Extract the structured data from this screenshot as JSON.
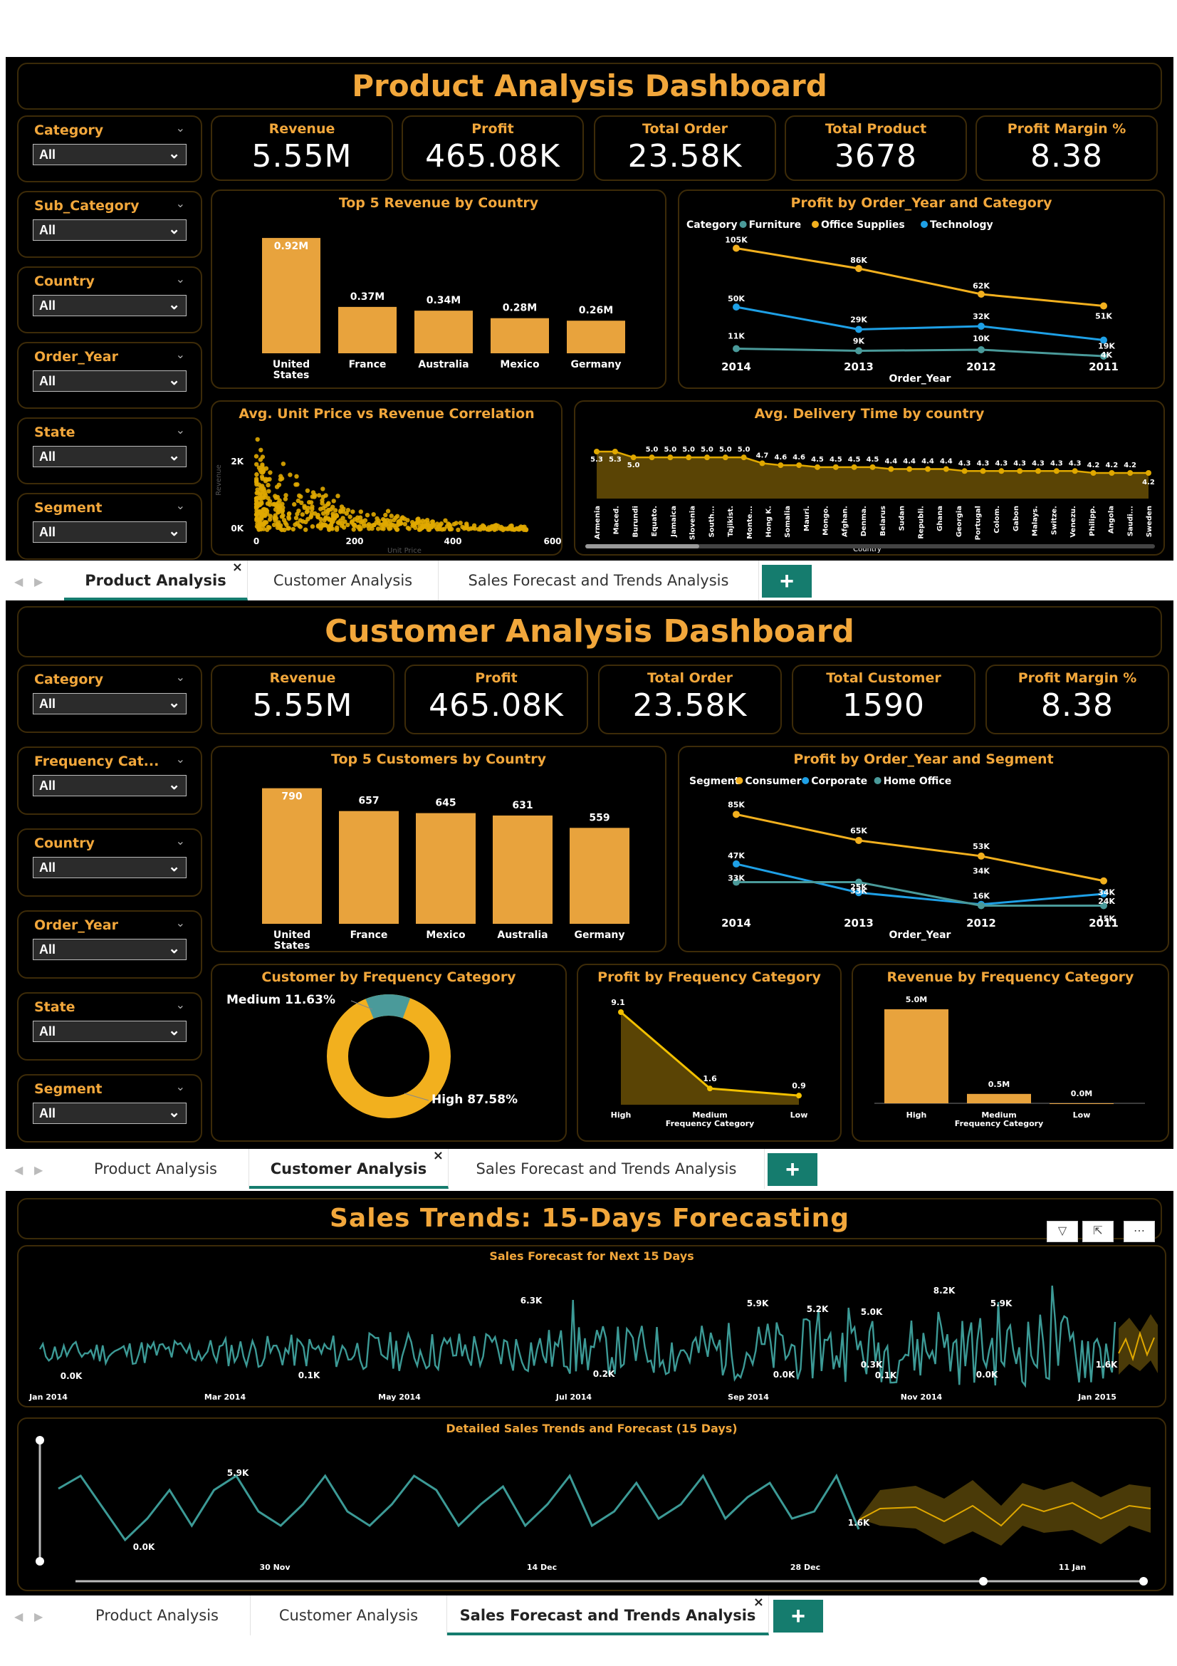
{
  "product": {
    "title": "Product Analysis Dashboard",
    "slicers": [
      {
        "label": "Category",
        "value": "All"
      },
      {
        "label": "Sub_Category",
        "value": "All"
      },
      {
        "label": "Country",
        "value": "All"
      },
      {
        "label": "Order_Year",
        "value": "All"
      },
      {
        "label": "State",
        "value": "All"
      },
      {
        "label": "Segment",
        "value": "All"
      }
    ],
    "kpis": [
      {
        "label": "Revenue",
        "value": "5.55M"
      },
      {
        "label": "Profit",
        "value": "465.08K"
      },
      {
        "label": "Total Order",
        "value": "23.58K"
      },
      {
        "label": "Total Product",
        "value": "3678"
      },
      {
        "label": "Profit Margin %",
        "value": "8.38"
      }
    ],
    "top5": {
      "title": "Top 5 Revenue by Country",
      "categories": [
        "United States",
        "France",
        "Australia",
        "Mexico",
        "Germany"
      ],
      "values": [
        0.92,
        0.37,
        0.34,
        0.28,
        0.26
      ],
      "labels": [
        "0.92M",
        "0.37M",
        "0.34M",
        "0.28M",
        "0.26M"
      ]
    },
    "profit_line": {
      "title": "Profit by Order_Year and Category",
      "legend_title": "Category",
      "legend": [
        "Furniture",
        "Office Supplies",
        "Technology"
      ],
      "xlabel": "Order_Year",
      "years": [
        "2014",
        "2013",
        "2012",
        "2011"
      ]
    },
    "scatter": {
      "title": "Avg. Unit Price vs Revenue Correlation",
      "ylabel": "Revenue",
      "xlabel": "Unit Price",
      "yticks": [
        "2K",
        "0K"
      ],
      "xticks": [
        "0",
        "200",
        "400",
        "600"
      ]
    },
    "delivery": {
      "title": "Avg. Delivery Time by country",
      "xlabel": "Country",
      "countries": [
        "Armenia",
        "Maced.",
        "Burundi",
        "Equato.",
        "Jamaica",
        "Slovenia",
        "South...",
        "Tajikist.",
        "Monte...",
        "Hong K.",
        "Somalia",
        "Mauri.",
        "Mongo.",
        "Afghan.",
        "Denma.",
        "Belarus",
        "Sudan",
        "Republi.",
        "Ghana",
        "Georgia",
        "Portugal",
        "Colom.",
        "Gabon",
        "Malays.",
        "Switze.",
        "Venezu.",
        "Philipp.",
        "Angola",
        "Saudi...",
        "Sweden"
      ],
      "values": [
        5.3,
        5.3,
        5.0,
        5.0,
        5.0,
        5.0,
        5.0,
        5.0,
        5.0,
        4.7,
        4.6,
        4.6,
        4.5,
        4.5,
        4.5,
        4.5,
        4.4,
        4.4,
        4.4,
        4.4,
        4.3,
        4.3,
        4.3,
        4.3,
        4.3,
        4.3,
        4.3,
        4.2,
        4.2,
        4.2,
        4.2
      ],
      "labels": [
        "5.3",
        "5.3",
        "5.0",
        "5.0",
        "5.0",
        "5.0",
        "5.0",
        "5.0",
        "5.0",
        "4.7",
        "4.6",
        "4.6",
        "4.5",
        "4.5",
        "4.5",
        "4.5",
        "4.4",
        "4.4",
        "4.4",
        "4.4",
        "4.3",
        "4.3",
        "4.3",
        "4.3",
        "4.3",
        "4.3",
        "4.3",
        "4.2",
        "4.2",
        "4.2",
        "4.2"
      ]
    }
  },
  "customer": {
    "title": "Customer Analysis Dashboard",
    "slicers": [
      {
        "label": "Category",
        "value": "All"
      },
      {
        "label": "Frequency Cat...",
        "value": "All"
      },
      {
        "label": "Country",
        "value": "All"
      },
      {
        "label": "Order_Year",
        "value": "All"
      },
      {
        "label": "State",
        "value": "All"
      },
      {
        "label": "Segment",
        "value": "All"
      }
    ],
    "kpis": [
      {
        "label": "Revenue",
        "value": "5.55M"
      },
      {
        "label": "Profit",
        "value": "465.08K"
      },
      {
        "label": "Total Order",
        "value": "23.58K"
      },
      {
        "label": "Total Customer",
        "value": "1590"
      },
      {
        "label": "Profit Margin %",
        "value": "8.38"
      }
    ],
    "top5": {
      "title": "Top 5 Customers by Country",
      "categories": [
        "United States",
        "France",
        "Mexico",
        "Australia",
        "Germany"
      ],
      "values": [
        790,
        657,
        645,
        631,
        559
      ],
      "labels": [
        "790",
        "657",
        "645",
        "631",
        "559"
      ]
    },
    "profit_line": {
      "title": "Profit by Order_Year and Segment",
      "legend_title": "Segment",
      "legend": [
        "Consumer",
        "Corporate",
        "Home Office"
      ],
      "xlabel": "Order_Year",
      "years": [
        "2014",
        "2013",
        "2012",
        "2011"
      ]
    },
    "donut": {
      "title": "Customer by Frequency Category",
      "medium_label": "Medium 11.63%",
      "high_label": "High 87.58%",
      "medium": 11.63,
      "high": 87.58
    },
    "profit_freq": {
      "title": "Profit by Frequency Category",
      "categories": [
        "High",
        "Medium",
        "Low"
      ],
      "values": [
        9.1,
        1.6,
        0.9
      ],
      "labels": [
        "9.1",
        "1.6",
        "0.9"
      ],
      "xlabel": "Frequency Category"
    },
    "revenue_freq": {
      "title": "Revenue by Frequency Category",
      "categories": [
        "High",
        "Medium",
        "Low"
      ],
      "values": [
        5.0,
        0.5,
        0.0
      ],
      "labels": [
        "5.0M",
        "0.5M",
        "0.0M"
      ],
      "xlabel": "Frequency Category"
    }
  },
  "forecast": {
    "title": "Sales Trends: 15-Days Forecasting",
    "chart1": {
      "title": "Sales Forecast for Next 15 Days",
      "xticks": [
        "Jan 2014",
        "Mar 2014",
        "May 2014",
        "Jul 2014",
        "Sep 2014",
        "Nov 2014",
        "Jan 2015"
      ],
      "annotations": [
        "6.3K",
        "5.9K",
        "5.2K",
        "5.0K",
        "8.2K",
        "5.9K",
        "0.0K",
        "0.1K",
        "0.2K",
        "0.0K",
        "0.3K",
        "0.1K",
        "0.0K",
        "1.6K"
      ]
    },
    "chart2": {
      "title": "Detailed Sales Trends and Forecast (15 Days)",
      "xticks": [
        "30 Nov",
        "14 Dec",
        "28 Dec",
        "11 Jan"
      ],
      "annotations": [
        "5.9K",
        "0.0K",
        "1.6K"
      ]
    }
  },
  "tabs": [
    "Product Analysis",
    "Customer Analysis",
    "Sales Forecast and Trends Analysis"
  ],
  "colors": {
    "accent": "#f2a73b",
    "bar": "#e8a33d",
    "teal": "#4a9a9a",
    "blue": "#1ea0e6",
    "tab_active": "#157c6e"
  }
}
